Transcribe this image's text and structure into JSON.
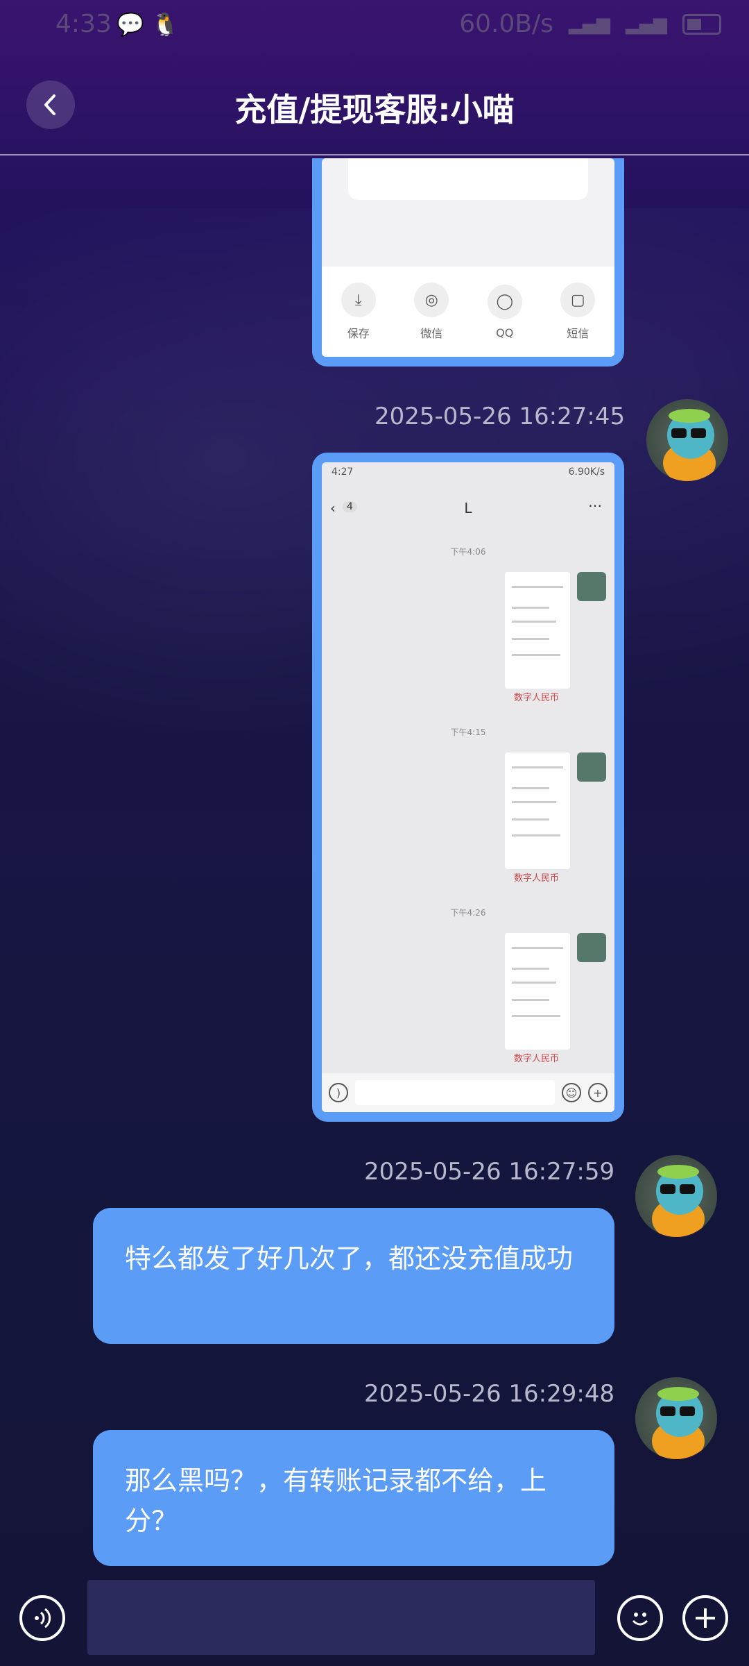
{
  "status_bar": {
    "time": "4:33",
    "network_speed": "60.0B/s"
  },
  "header": {
    "title": "充值/提现客服:小喵"
  },
  "image1": {
    "share_items": [
      "保存",
      "微信",
      "QQ",
      "短信"
    ]
  },
  "messages": [
    {
      "timestamp": "2025-05-26 16:27:45",
      "type": "image"
    },
    {
      "timestamp": "2025-05-26 16:27:59",
      "type": "text",
      "text": "特么都发了好几次了，都还没充值成功"
    },
    {
      "timestamp": "2025-05-26 16:29:48",
      "type": "text",
      "text": "那么黑吗？，有转账记录都不给，上分？"
    }
  ],
  "inner_screenshot": {
    "time": "4:27",
    "speed": "6.90K/s",
    "back_count": "4",
    "title": "L",
    "timestamps": [
      "下午4:06",
      "下午4:15",
      "下午4:26"
    ],
    "tag": "数字人民币"
  },
  "icons": {
    "back": "chevron-left-icon",
    "voice": "voice-icon",
    "emoji": "emoji-icon",
    "add": "plus-icon"
  },
  "colors": {
    "bubble": "#5a9cf6",
    "input_bg": "#2b2c5d"
  }
}
